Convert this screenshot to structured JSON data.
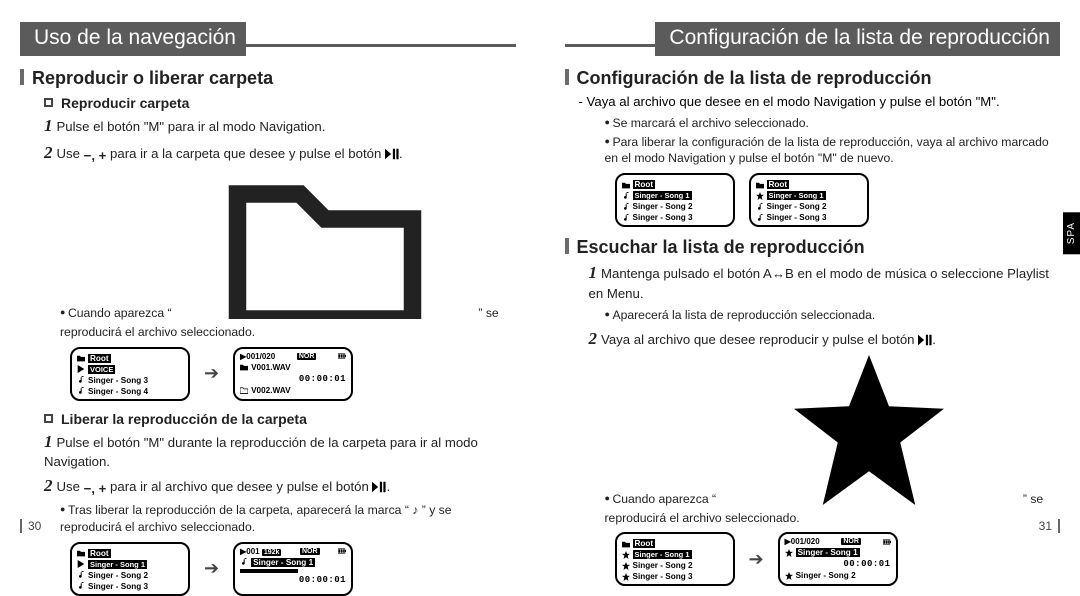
{
  "pageLeft": {
    "number": "30",
    "runningHead": "Uso de la navegación",
    "section": "Reproducir o liberar carpeta",
    "partA": {
      "title": "Reproducir carpeta",
      "step1": "Pulse el botón \"M\" para ir al modo Navigation.",
      "step2_pre": "Use ",
      "step2_icons": "−, +",
      "step2_post": " para ir a la carpeta que desee y pulse el botón ",
      "bullet1_pre": "Cuando aparezca “ ",
      "bullet1_post": " ” se reproducirá el archivo seleccionado."
    },
    "partB": {
      "title": "Liberar la reproducción de la carpeta",
      "step1": "Pulse el botón \"M\" durante la reproducción de la carpeta para ir al modo Navigation.",
      "step2_pre": "Use ",
      "step2_icons": "−, +",
      "step2_post": " para ir al archivo que desee y pulse el botón ",
      "bullet1": "Tras liberar la reproducción de la carpeta, aparecerá la marca “ ♪ ” y se reproducirá el archivo seleccionado."
    }
  },
  "pageRight": {
    "number": "31",
    "runningHead": "Configuración de la lista de reproducción",
    "tab": "SPA",
    "sectionA": {
      "title": "Configuración de la lista de reproducción",
      "intro": "- Vaya al archivo que desee en el modo Navigation y pulse el botón \"M\".",
      "bullet1": "Se marcará el archivo seleccionado.",
      "bullet2": "Para liberar la configuración de la lista de reproducción, vaya al archivo marcado en el modo Navigation y pulse el botón \"M\" de nuevo."
    },
    "sectionB": {
      "title": "Escuchar la lista de reproducción",
      "step1": "Mantenga pulsado el botón A↔B en el modo de música o seleccione Playlist en Menu.",
      "bullet1": "Aparecerá la lista de reproducción seleccionada.",
      "step2": "Vaya al archivo que desee reproducir y pulse el botón ",
      "bullet2_pre": "Cuando aparezca “ ",
      "bullet2_post": " ” se reproducirá el archivo seleccionado."
    }
  },
  "lcd": {
    "root": "Root",
    "voice": "VOICE",
    "s1": "Singer - Song 1",
    "s2": "Singer - Song 2",
    "s3": "Singer - Song 3",
    "s4": "Singer - Song 4",
    "v1": "V001.WAV",
    "v2": "V002.WAV",
    "track": "001/020",
    "track001": "001",
    "rate": "192k",
    "nor": "NOR",
    "time": "00:00:01"
  }
}
